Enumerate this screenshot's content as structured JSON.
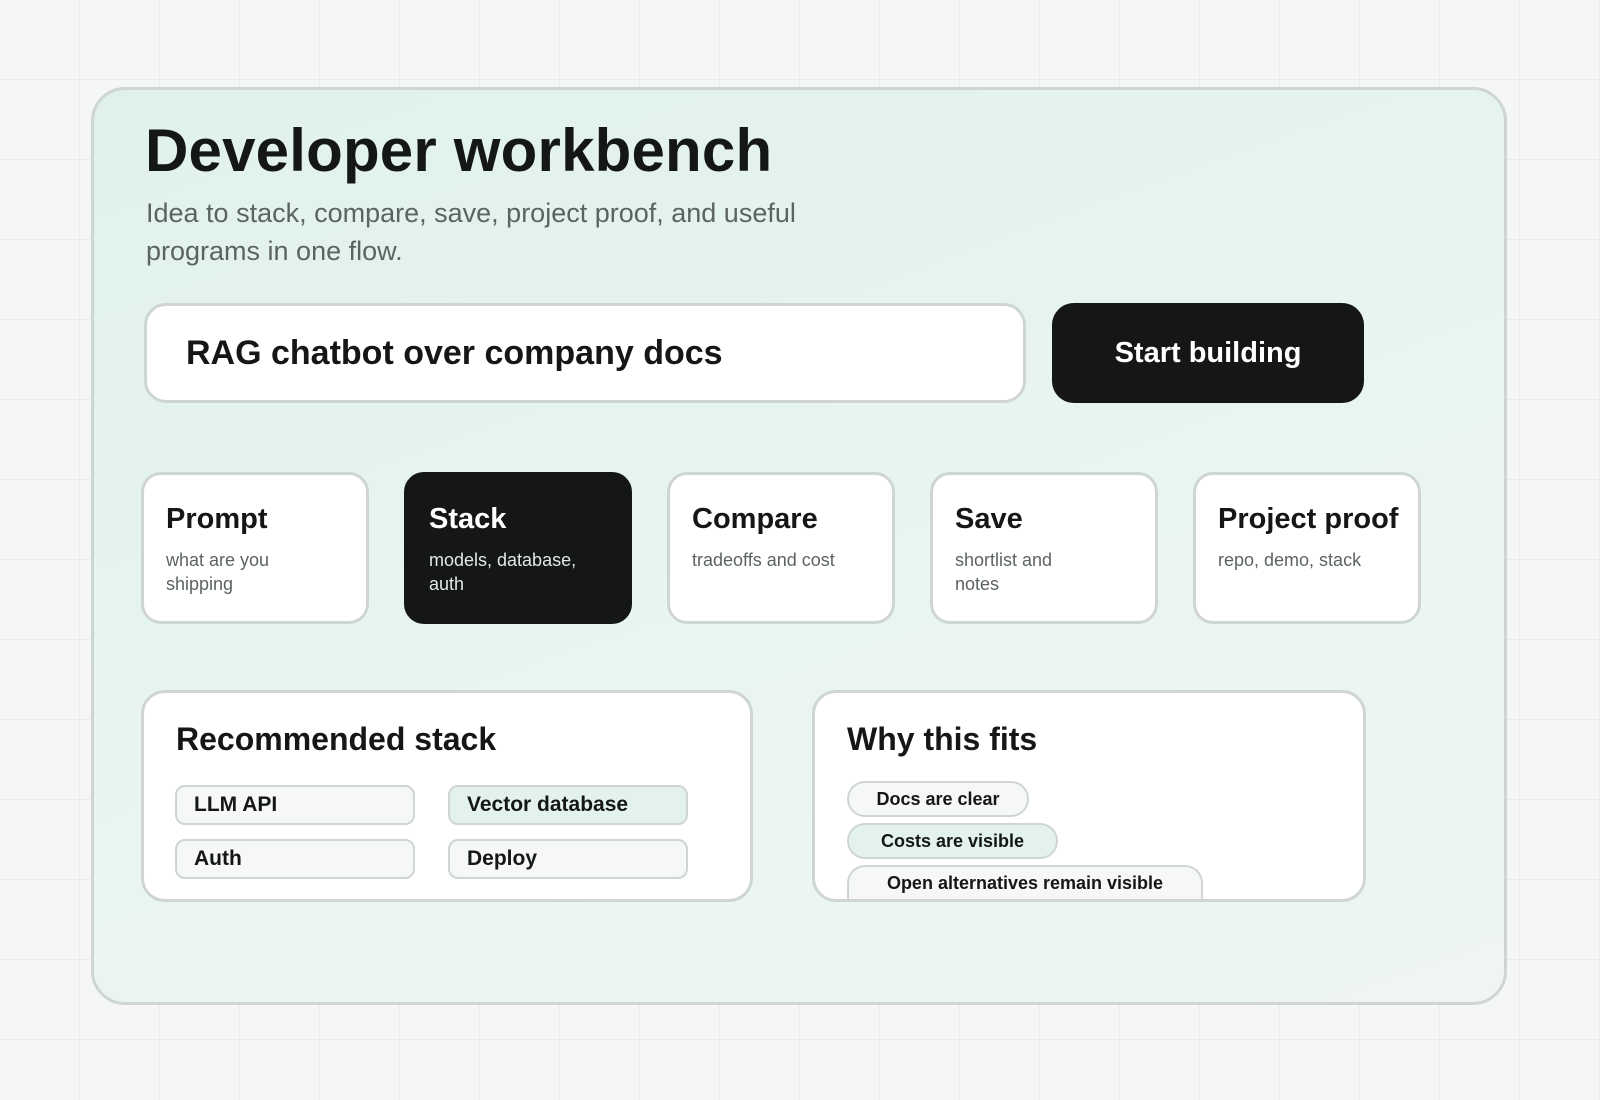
{
  "header": {
    "title": "Developer workbench",
    "subtitle": "Idea to stack, compare, save, project proof, and useful programs in one flow."
  },
  "prompt": {
    "value": "RAG chatbot over company docs",
    "button_label": "Start building"
  },
  "steps": [
    {
      "title": "Prompt",
      "desc": "what are you shipping",
      "active": false
    },
    {
      "title": "Stack",
      "desc": "models, database, auth",
      "active": true
    },
    {
      "title": "Compare",
      "desc": "tradeoffs and cost",
      "active": false
    },
    {
      "title": "Save",
      "desc": "shortlist and notes",
      "active": false
    },
    {
      "title": "Project proof",
      "desc": "repo, demo, stack",
      "active": false
    }
  ],
  "recommended": {
    "title": "Recommended stack",
    "items": [
      "LLM API",
      "Vector database",
      "Auth",
      "Deploy"
    ]
  },
  "why": {
    "title": "Why this fits",
    "reasons": [
      "Docs are clear",
      "Costs are visible",
      "Open alternatives remain visible"
    ]
  },
  "colors": {
    "accent_dark": "#141617",
    "panel_tint": "#e6f4f0",
    "chip_tint": "#e3f2ee",
    "border": "#cfd6d2"
  }
}
